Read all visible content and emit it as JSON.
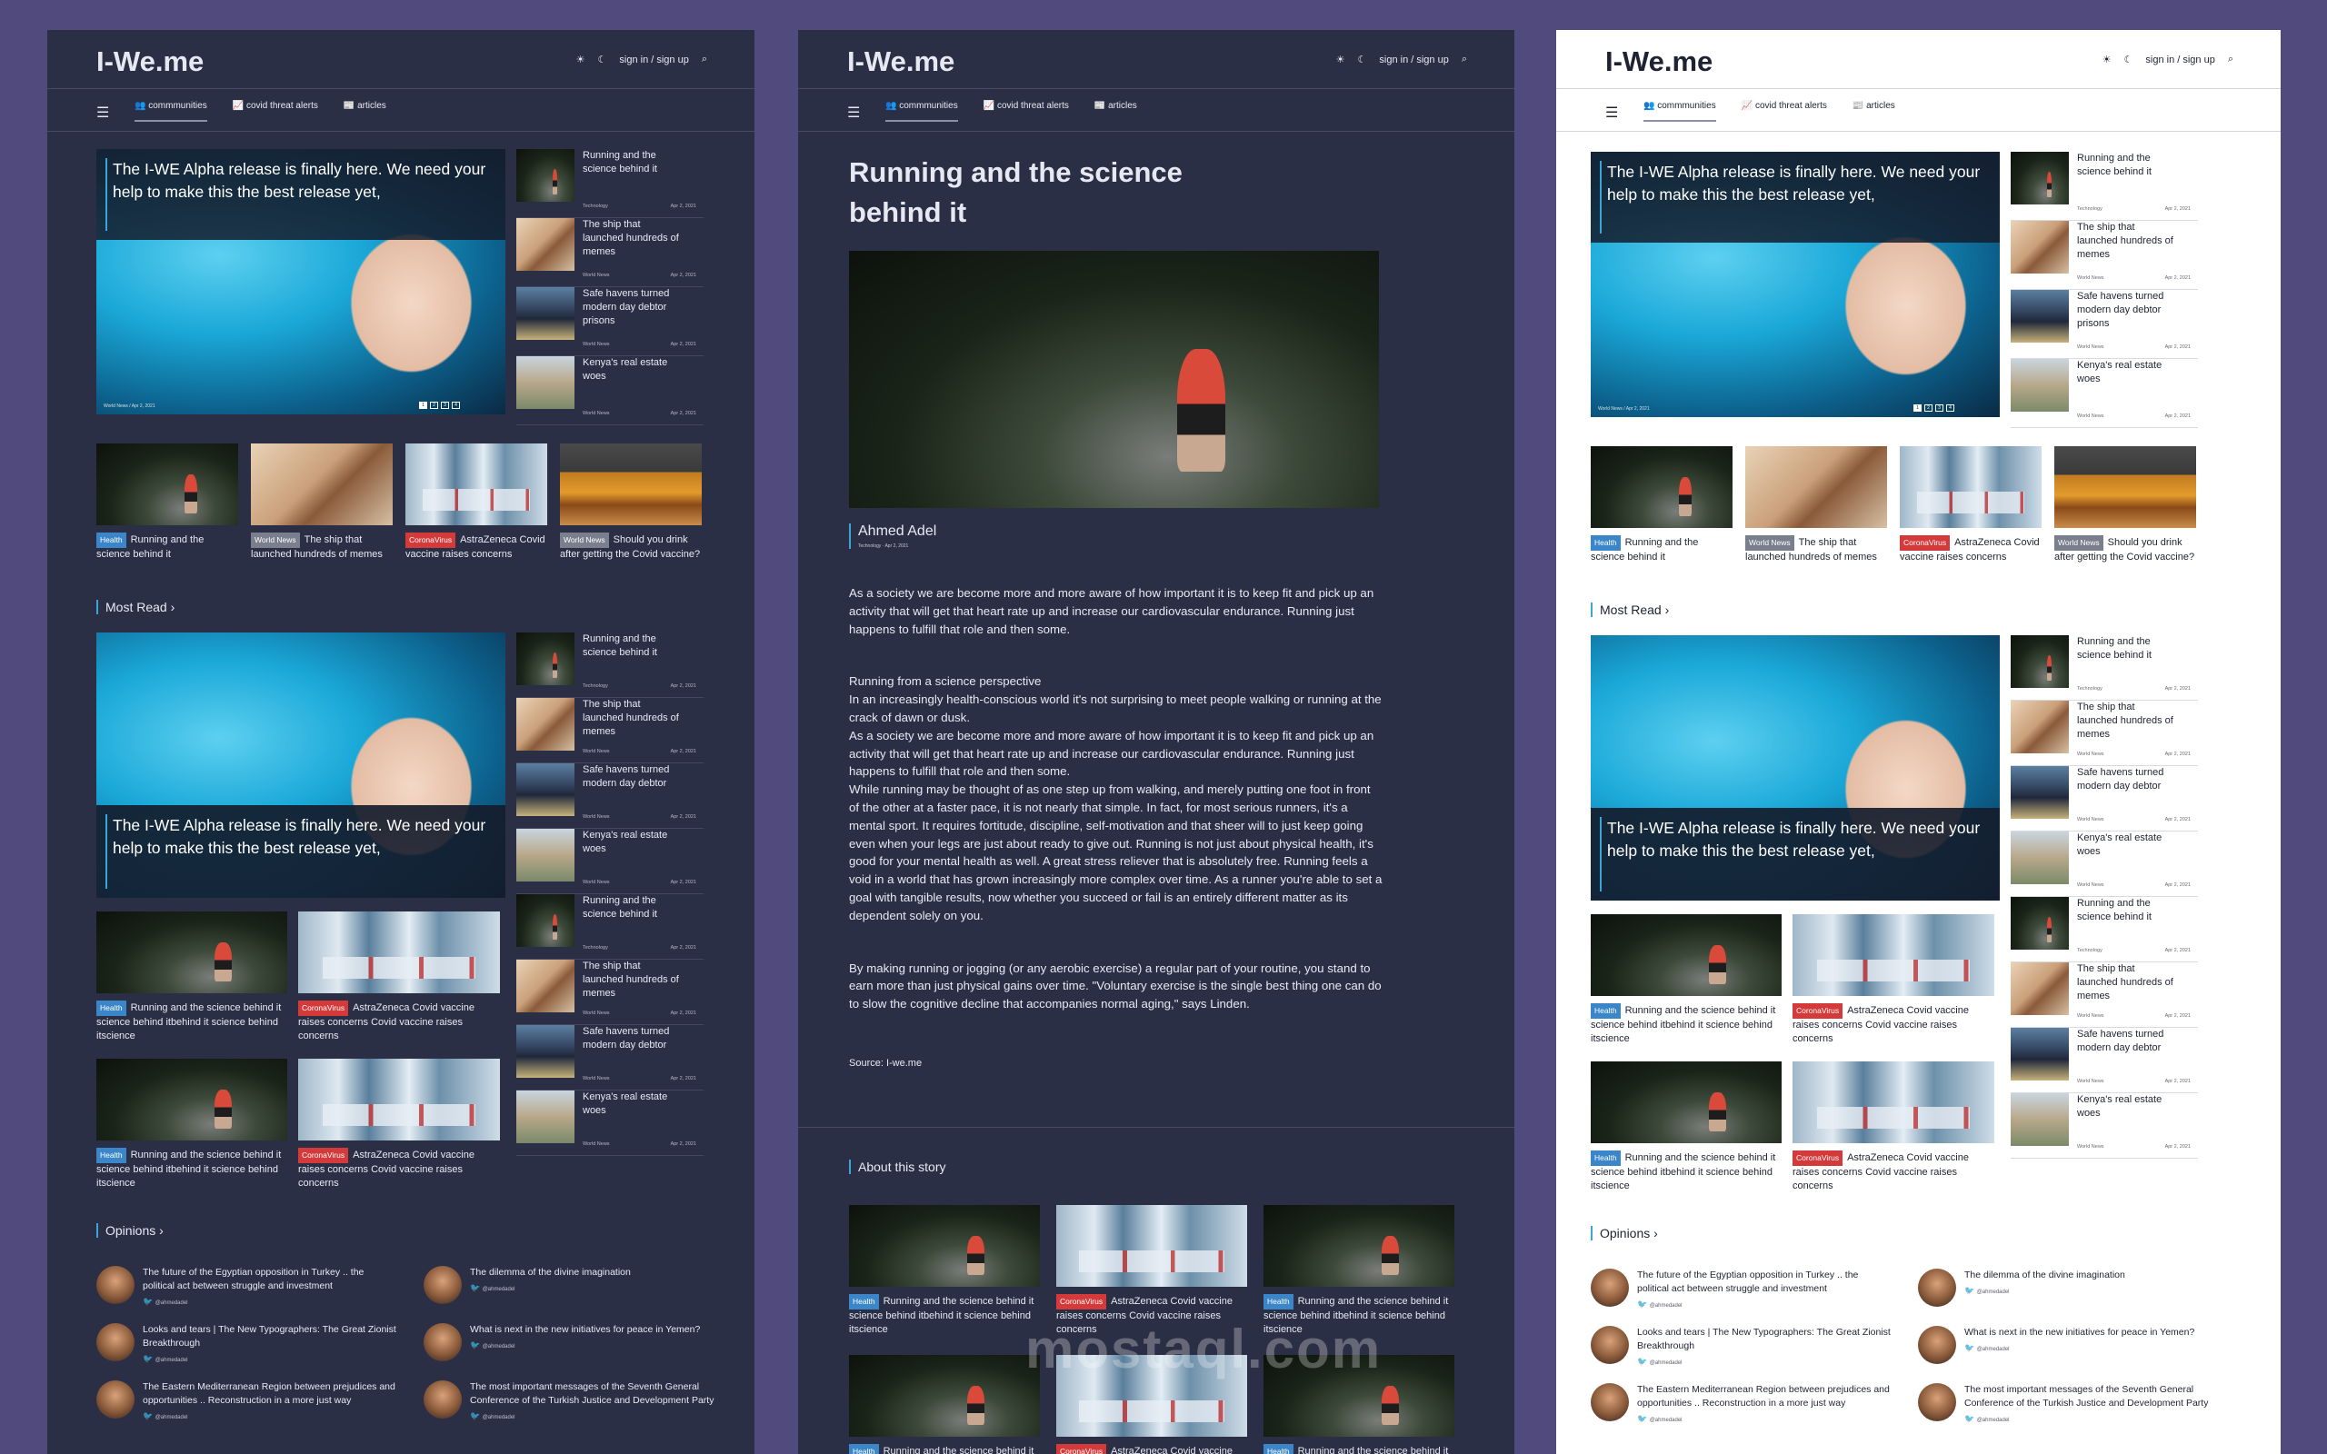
{
  "header": {
    "logo": "I-We.me",
    "auth": "sign in / sign up",
    "sun_icon": "sun-icon",
    "moon_icon": "moon-icon",
    "search_icon": "search-icon"
  },
  "nav": {
    "menu_icon": "menu-icon",
    "tabs": [
      {
        "label": "commmunities",
        "icon": "people-icon"
      },
      {
        "label": "covid threat alerts",
        "icon": "chart-icon"
      },
      {
        "label": "articles",
        "icon": "article-icon"
      }
    ]
  },
  "hero": {
    "title": "The I-WE Alpha release is finally here. We need your help to make this the best release yet,",
    "category": "World News",
    "date": "Apr 2, 2021",
    "pages": [
      "1",
      "2",
      "3",
      "4"
    ]
  },
  "side_items": [
    {
      "title": "Running and the science behind it",
      "category": "Technology",
      "date": "Apr 2, 2021"
    },
    {
      "title": "The ship that launched hundreds of memes",
      "category": "World News",
      "date": "Apr 2, 2021"
    },
    {
      "title": "Safe havens turned modern day debtor prisons",
      "category": "World News",
      "date": "Apr 2, 2021"
    },
    {
      "title": "Kenya's real estate woes",
      "category": "World News",
      "date": "Apr 2, 2021"
    }
  ],
  "most_read_side": [
    {
      "title": "Running and the science behind it",
      "category": "Technology",
      "date": "Apr 2, 2021"
    },
    {
      "title": "The ship that launched hundreds of memes",
      "category": "World News",
      "date": "Apr 2, 2021"
    },
    {
      "title": "Safe havens turned modern day debtor",
      "category": "World News",
      "date": "Apr 2, 2021"
    },
    {
      "title": "Kenya's real estate woes",
      "category": "World News",
      "date": "Apr 2, 2021"
    },
    {
      "title": "Running and the science behind it",
      "category": "Technology",
      "date": "Apr 2, 2021"
    },
    {
      "title": "The ship that launched hundreds of memes",
      "category": "World News",
      "date": "Apr 2, 2021"
    },
    {
      "title": "Safe havens turned modern day debtor",
      "category": "World News",
      "date": "Apr 2, 2021"
    },
    {
      "title": "Kenya's real estate woes",
      "category": "World News",
      "date": "Apr 2, 2021"
    }
  ],
  "cards": [
    {
      "badge": "Health",
      "text": "Running and the science behind it"
    },
    {
      "badge": "World News",
      "text": "The ship that launched hundreds of memes"
    },
    {
      "badge": "CoronaVirus",
      "text": "AstraZeneca Covid vaccine raises concerns"
    },
    {
      "badge": "World News",
      "text": "Should you drink after getting the Covid vaccine?"
    }
  ],
  "most_read": {
    "title": "Most Read",
    "chevron": "chevron-right-icon"
  },
  "grid_cards": [
    {
      "badge": "Health",
      "text": "Running and the science behind it science behind itbehind it science behind itscience"
    },
    {
      "badge": "CoronaVirus",
      "text": "AstraZeneca Covid vaccine raises concerns Covid vaccine raises concerns"
    }
  ],
  "opinions": {
    "title": "Opinions",
    "items": [
      {
        "text": "The future of the Egyptian opposition in Turkey .. the political act between struggle and investment",
        "handle": "@ahmedadel"
      },
      {
        "text": "The dilemma of the divine imagination",
        "handle": "@ahmedadel"
      },
      {
        "text": "Looks and tears | The New Typographers: The Great Zionist Breakthrough",
        "handle": "@ahmedadel"
      },
      {
        "text": "What is next in the new initiatives for peace in Yemen?",
        "handle": "@ahmedadel"
      },
      {
        "text": "The Eastern Mediterranean Region between prejudices and opportunities .. Reconstruction in a more just way",
        "handle": "@ahmedadel"
      },
      {
        "text": "The most important messages of the Seventh General Conference of the Turkish Justice and Development Party",
        "handle": "@ahmedadel"
      }
    ]
  },
  "article": {
    "title": "Running and the science behind it",
    "author": "Ahmed Adel",
    "category": "Technology",
    "date": "Apr 2, 2021",
    "p1": "As a society we are become more and more aware of how important it is to keep fit and pick up an activity that will get that heart rate up and increase our cardiovascular endurance. Running just happens to fulfill that role and then some.",
    "p2": "Running from a science perspective\nIn an increasingly health-conscious world it's not surprising to meet people walking or running at the crack of dawn or dusk.\nAs a society we are become more and more aware of how important it is to keep fit and pick up an activity that will get that heart rate up and increase our cardiovascular endurance. Running just happens to fulfill that role and then some.\nWhile running may be thought of as one step up from walking, and merely putting one foot in front of the other at a faster pace, it is not nearly that simple. In fact, for most serious runners, it's a mental sport. It requires fortitude, discipline, self-motivation and that sheer will to just keep going even when your legs are just about ready to give out. Running is not just about physical health, it's good for your mental health as well. A great stress reliever that is absolutely free. Running feels a void in a world that has grown increasingly more complex over time. As a runner you're able to set a goal with tangible results, now whether you succeed or fail is an entirely different matter as its dependent solely on you.",
    "p3": "By making running or jogging (or any aerobic exercise) a regular part of your routine, you stand to earn more than just physical gains over time. \"Voluntary exercise is the single best thing one can do to slow the cognitive decline that accompanies normal aging,\" says Linden.",
    "source": "Source: I-we.me",
    "about": "About this story"
  },
  "watermark": "mostaql.com",
  "colors": {
    "dark_bg": "#2b2f45",
    "light_bg": "#ffffff",
    "page_bg": "#514a7d",
    "accent": "#3aa6d8",
    "health": "#3a86c8",
    "corona": "#d43a3a",
    "world": "#7a7f8e"
  }
}
